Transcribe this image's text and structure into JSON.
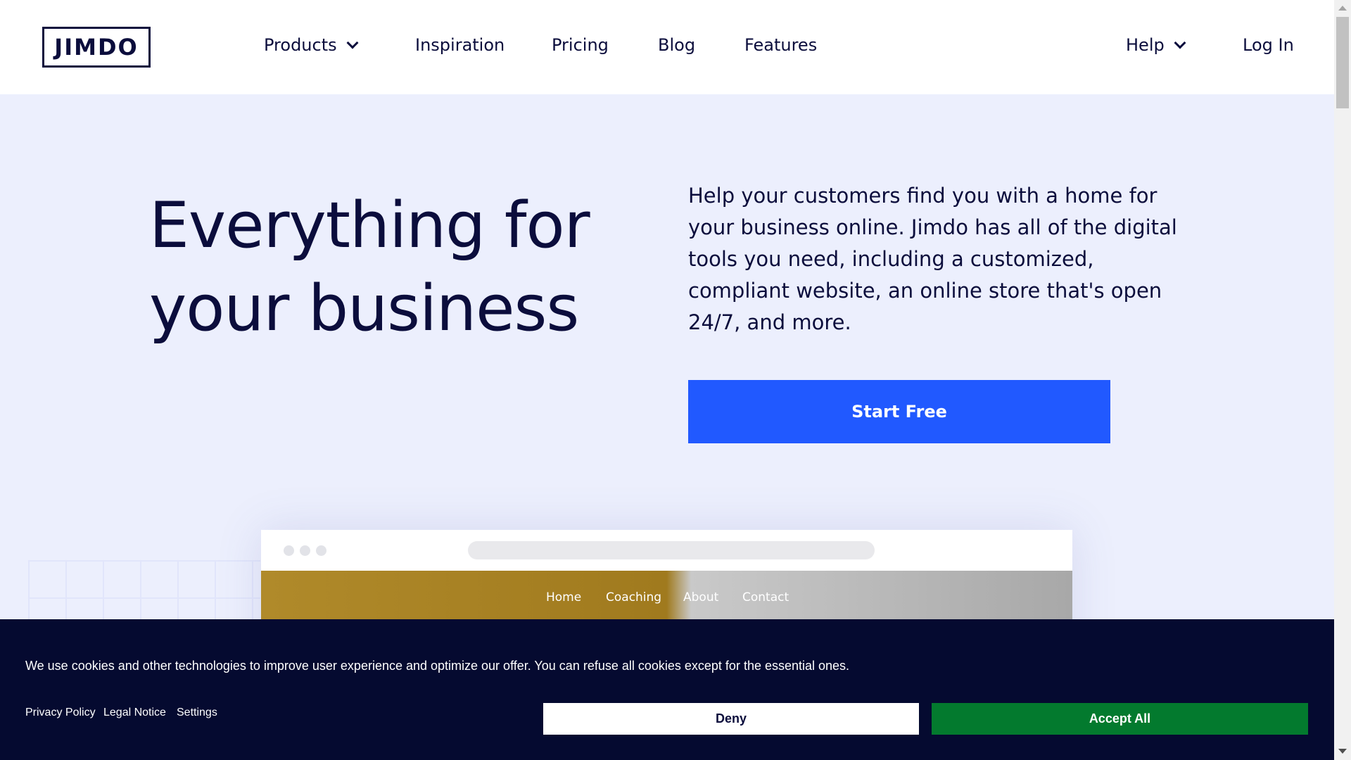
{
  "header": {
    "logo_text": "JIMDO",
    "nav": {
      "products": "Products",
      "inspiration": "Inspiration",
      "pricing": "Pricing",
      "blog": "Blog",
      "features": "Features",
      "help": "Help",
      "login": "Log In"
    }
  },
  "hero": {
    "title_line1": "Everything for",
    "title_line2": "your business",
    "description": "Help your customers find you with a home for your business online. Jimdo has all of the digital tools you need, including a customized, compliant website, an online store that's open 24/7, and more.",
    "cta_label": "Start Free"
  },
  "mockup": {
    "nav": [
      "Home",
      "Coaching",
      "About",
      "Contact"
    ]
  },
  "cookie_banner": {
    "text": "We use cookies and other technologies to improve user experience and optimize our offer. You can refuse all cookies except for the essential ones.",
    "links": [
      "Privacy Policy",
      "Legal Notice",
      "Settings"
    ],
    "deny_label": "Deny",
    "accept_label": "Accept All"
  },
  "colors": {
    "brand_navy": "#0b0d3c",
    "cta_blue": "#2159ff",
    "hero_bg": "#eceffd",
    "cookie_bg": "#050a30",
    "accept_green": "#037a2e"
  }
}
